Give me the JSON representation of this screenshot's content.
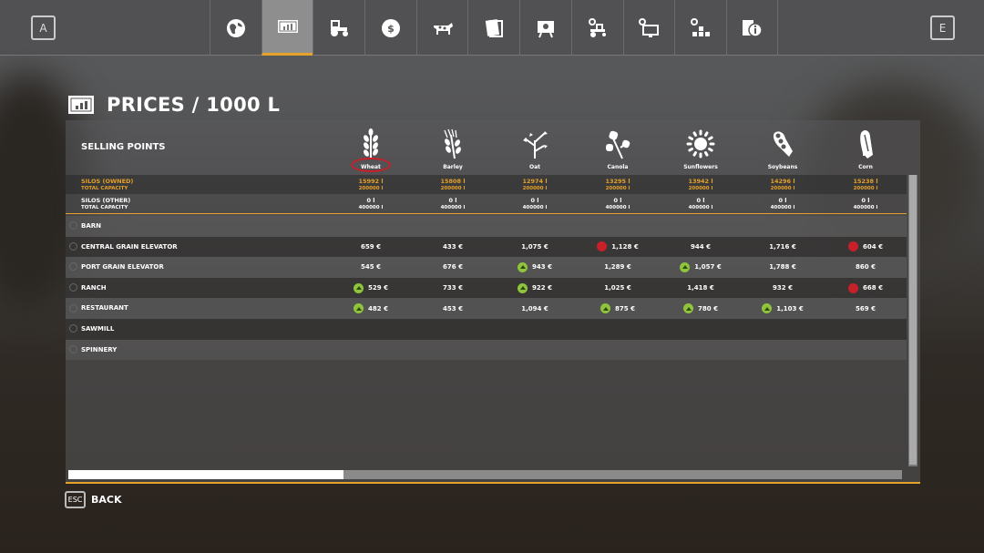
{
  "topbar": {
    "left_key": "A",
    "right_key": "E",
    "tabs": [
      {
        "icon": "globe-icon"
      },
      {
        "icon": "prices-chart-icon",
        "active": true
      },
      {
        "icon": "tractor-icon"
      },
      {
        "icon": "money-icon"
      },
      {
        "icon": "cow-icon"
      },
      {
        "icon": "contracts-icon"
      },
      {
        "icon": "tutorial-board-icon"
      },
      {
        "icon": "vehicle-settings-icon"
      },
      {
        "icon": "display-settings-icon"
      },
      {
        "icon": "production-icon"
      },
      {
        "icon": "help-info-icon"
      }
    ]
  },
  "page": {
    "title": "PRICES / 1000 L"
  },
  "table": {
    "selling_points_label": "SELLING POINTS",
    "crops": [
      "Wheat",
      "Barley",
      "Oat",
      "Canola",
      "Sunflowers",
      "Soybeans",
      "Corn"
    ],
    "highlighted_crop": "Wheat",
    "silos_owned": {
      "label": "SILOS (OWNED)",
      "cap_label": "TOTAL CAPACITY",
      "values": [
        "15992 l",
        "15808 l",
        "12974 l",
        "13295 l",
        "13942 l",
        "14296 l",
        "15238 l"
      ],
      "caps": [
        "200000 l",
        "200000 l",
        "200000 l",
        "200000 l",
        "200000 l",
        "200000 l",
        "200000 l"
      ]
    },
    "silos_other": {
      "label": "SILOS (OTHER)",
      "cap_label": "TOTAL CAPACITY",
      "values": [
        "0 l",
        "0 l",
        "0 l",
        "0 l",
        "0 l",
        "0 l",
        "0 l"
      ],
      "caps": [
        "400000 l",
        "400000 l",
        "400000 l",
        "400000 l",
        "400000 l",
        "400000 l",
        "400000 l"
      ]
    },
    "rows": [
      {
        "name": "BARN",
        "cells": []
      },
      {
        "name": "CENTRAL GRAIN ELEVATOR",
        "cells": [
          {
            "v": "659 €"
          },
          {
            "v": "433 €"
          },
          {
            "v": "1,075 €"
          },
          {
            "v": "1,128 €",
            "t": "down"
          },
          {
            "v": "944 €"
          },
          {
            "v": "1,716 €"
          },
          {
            "v": "604 €",
            "t": "down"
          }
        ]
      },
      {
        "name": "PORT GRAIN ELEVATOR",
        "cells": [
          {
            "v": "545 €"
          },
          {
            "v": "676 €"
          },
          {
            "v": "943 €",
            "t": "up"
          },
          {
            "v": "1,289 €"
          },
          {
            "v": "1,057 €",
            "t": "up"
          },
          {
            "v": "1,788 €"
          },
          {
            "v": "860 €"
          }
        ]
      },
      {
        "name": "RANCH",
        "cells": [
          {
            "v": "529 €",
            "t": "up"
          },
          {
            "v": "733 €"
          },
          {
            "v": "922 €",
            "t": "up"
          },
          {
            "v": "1,025 €"
          },
          {
            "v": "1,418 €"
          },
          {
            "v": "932 €"
          },
          {
            "v": "668 €",
            "t": "down"
          }
        ]
      },
      {
        "name": "RESTAURANT",
        "cells": [
          {
            "v": "482 €",
            "t": "up"
          },
          {
            "v": "453 €"
          },
          {
            "v": "1,094 €"
          },
          {
            "v": "875 €",
            "t": "up"
          },
          {
            "v": "780 €",
            "t": "up"
          },
          {
            "v": "1,103 €",
            "t": "up"
          },
          {
            "v": "569 €"
          }
        ]
      },
      {
        "name": "SAWMILL",
        "cells": []
      },
      {
        "name": "SPINNERY",
        "cells": []
      }
    ],
    "hscroll_fraction": 0.33
  },
  "footer": {
    "esc_key": "ESC",
    "back_label": "BACK"
  },
  "colors": {
    "accent": "#e6a12a",
    "up": "#8fc43c",
    "down": "#c8202a",
    "highlight": "#c8202a"
  }
}
